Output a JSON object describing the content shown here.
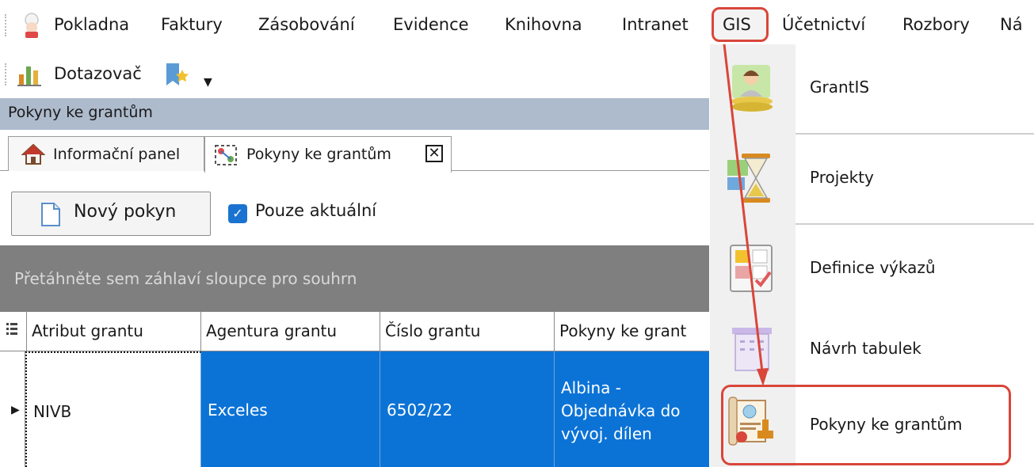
{
  "menu": {
    "items": [
      "Pokladna",
      "Faktury",
      "Zásobování",
      "Evidence",
      "Knihovna",
      "Intranet",
      "GIS",
      "Účetnictví",
      "Rozbory",
      "Ná"
    ],
    "highlighted": "GIS"
  },
  "toolbar": {
    "query_label": "Dotazovač"
  },
  "panel": {
    "title": "Pokyny ke grantům"
  },
  "tabs": [
    {
      "label": "Informační panel",
      "icon": "home-icon"
    },
    {
      "label": "Pokyny ke grantům",
      "icon": "grant-instructions-icon",
      "active": true
    }
  ],
  "actions": {
    "new_button": "Nový pokyn",
    "checkbox_label": "Pouze aktuální",
    "checkbox_checked": true
  },
  "grid": {
    "group_hint": "Přetáhněte sem záhlaví sloupce pro souhrn",
    "columns": [
      "Atribut grantu",
      "Agentura grantu",
      "Číslo grantu",
      "Pokyny ke grant"
    ],
    "rows": [
      [
        "NIVB",
        "Exceles",
        "6502/22",
        "Albina - Objednávka do vývoj. dílen"
      ]
    ]
  },
  "dropdown": {
    "items": [
      {
        "label": "GrantIS",
        "icon": "person-coins-icon"
      },
      {
        "label": "Projekty",
        "icon": "hourglass-icon"
      },
      {
        "label": "Definice výkazů",
        "icon": "report-definition-icon"
      },
      {
        "label": "Návrh tabulek",
        "icon": "table-design-icon"
      },
      {
        "label": "Pokyny ke grantům",
        "icon": "grant-certificate-icon"
      }
    ],
    "highlighted": "Pokyny ke grantům"
  },
  "colors": {
    "selection": "#0c73d6",
    "highlight": "#d9463a",
    "title_strip": "#aebbcd",
    "group_panel": "#7f7f7f"
  }
}
